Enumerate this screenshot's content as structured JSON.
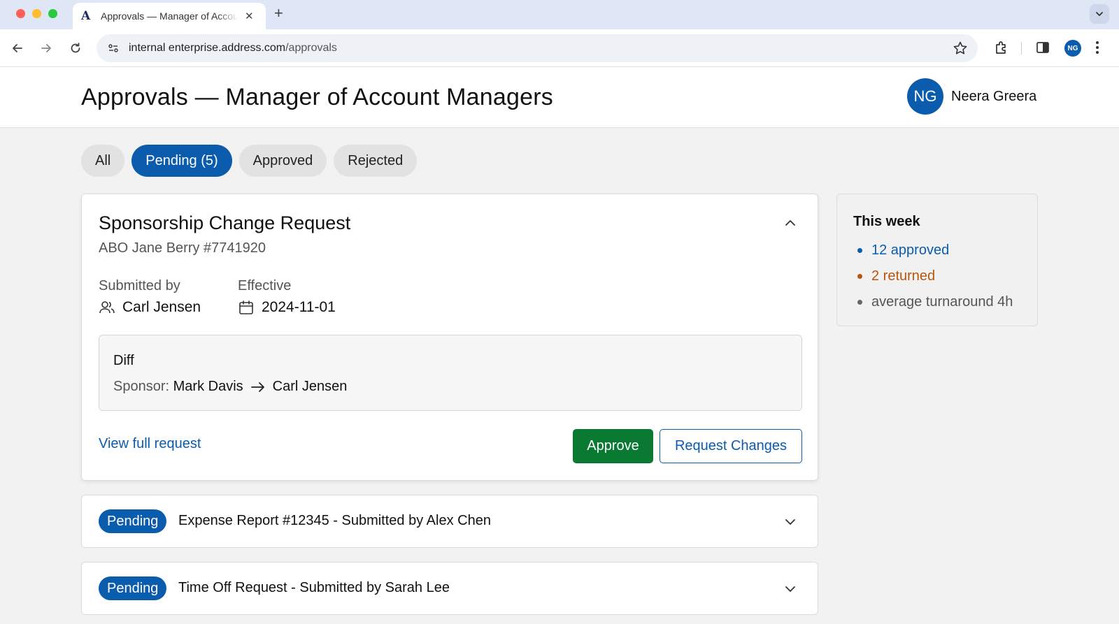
{
  "browser": {
    "tab_title": "Approvals — Manager of Account Managers",
    "tab_favicon": "A",
    "new_tab": "+",
    "close_tab": "✕",
    "url_host": "internal enterprise.address.com",
    "url_path": "/approvals",
    "profile_initials": "NG"
  },
  "header": {
    "title": "Approvals — Manager of Account Managers",
    "user_initials": "NG",
    "user_name": "Neera Greera"
  },
  "filters": [
    {
      "label": "All",
      "active": false
    },
    {
      "label": "Pending (5)",
      "active": true
    },
    {
      "label": "Approved",
      "active": false
    },
    {
      "label": "Rejected",
      "active": false
    }
  ],
  "expanded_request": {
    "title": "Sponsorship Change Request",
    "subtitle": "ABO Jane Berry #7741920",
    "submitted_by_label": "Submitted by",
    "submitted_by": "Carl Jensen",
    "effective_label": "Effective",
    "effective_date": "2024-11-01",
    "diff_title": "Diff",
    "diff_key": "Sponsor:",
    "diff_from": "Mark Davis",
    "diff_to": "Carl Jensen",
    "view_link": "View full request",
    "approve_label": "Approve",
    "request_changes_label": "Request Changes"
  },
  "collapsed_requests": [
    {
      "badge": "Pending",
      "text": "Expense Report #12345 - Submitted by Alex Chen"
    },
    {
      "badge": "Pending",
      "text": "Time Off Request - Submitted by Sarah Lee"
    }
  ],
  "summary": {
    "title": "This week",
    "items": [
      {
        "text": "12 approved",
        "color": "#0b5cad"
      },
      {
        "text": "2 returned",
        "color": "#b8560f"
      },
      {
        "text": "average turnaround 4h",
        "color": "#555555"
      }
    ]
  },
  "colors": {
    "primary": "#0b5cad",
    "approve_green": "#0a7a32",
    "returned_orange": "#b8560f"
  }
}
